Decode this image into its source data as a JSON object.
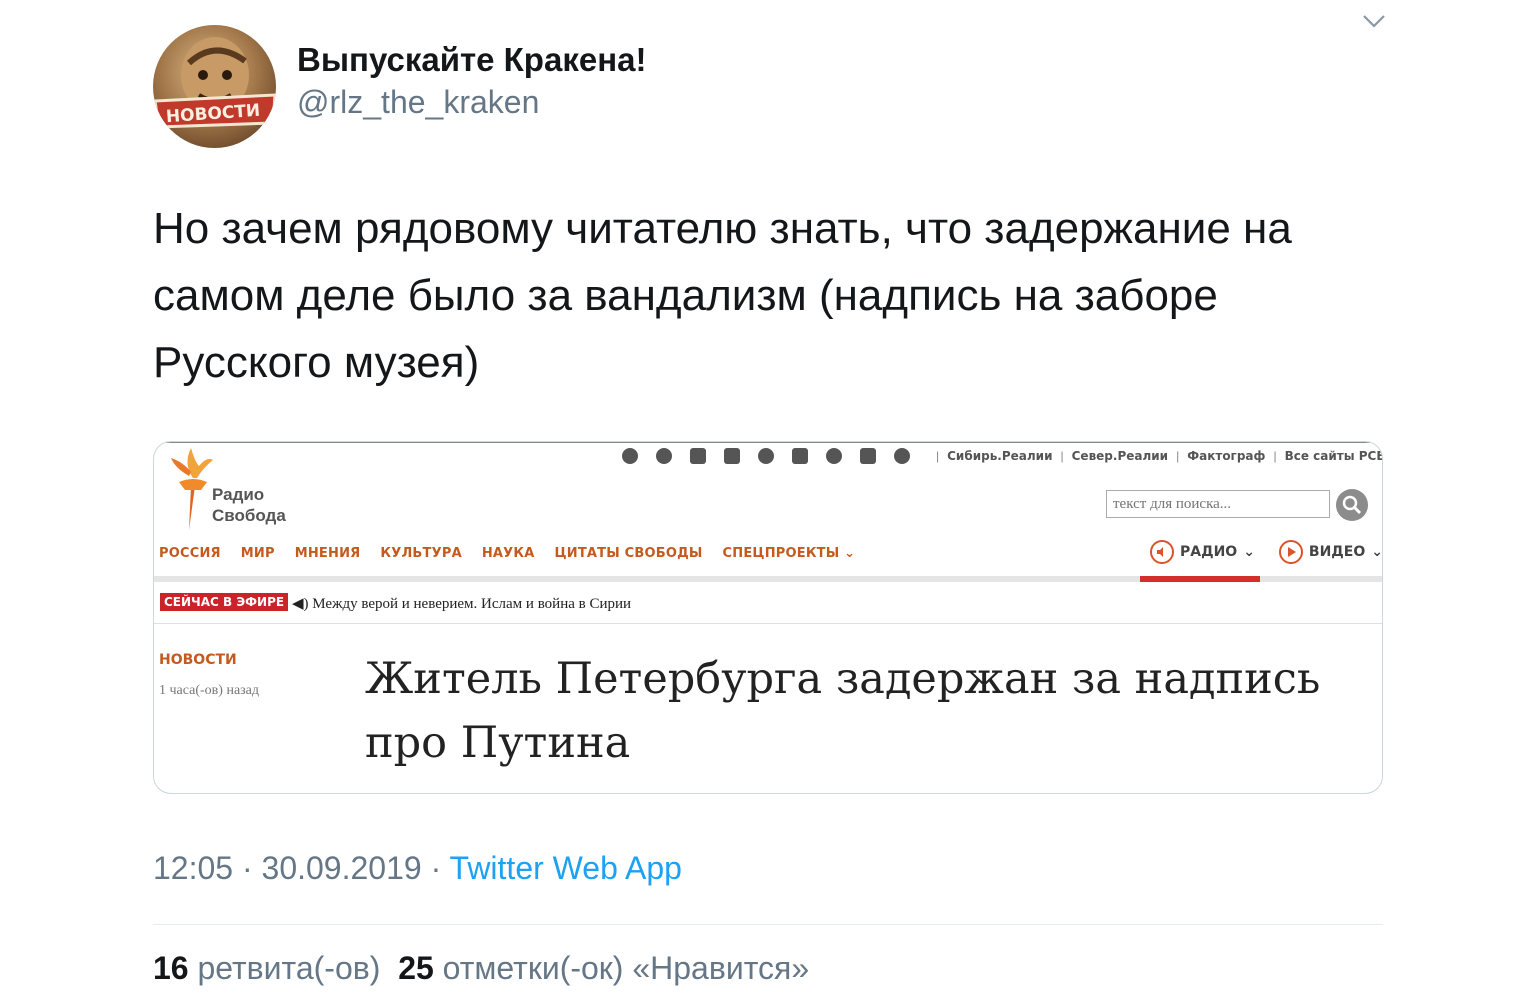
{
  "tweet": {
    "display_name": "Выпускайте Кракена!",
    "handle": "@rlz_the_kraken",
    "avatar_label": "НОВОСТИ",
    "text": "Но зачем рядовому читателю знать, что задержание на самом деле было за вандализм (надпись на заборе Русского музея)",
    "time": "12:05",
    "date": "30.09.2019",
    "source": "Twitter Web App",
    "retweets_count": "16",
    "retweets_label": "ретвита(-ов)",
    "likes_count": "25",
    "likes_label": "отметки(-ок) «Нравится»"
  },
  "card": {
    "top_links": [
      "Сибирь.Реалии",
      "Север.Реалии",
      "Фактограф",
      "Все сайты РСЕ/РС"
    ],
    "social_icons": [
      "facebook-icon",
      "twitter-icon",
      "youtube-icon",
      "vk-icon",
      "telegram-icon",
      "plus-icon",
      "soundcloud-icon",
      "instagram-icon",
      "odnoklassniki-icon"
    ],
    "logo_line1": "Радио",
    "logo_line2": "Свобода",
    "search_placeholder": "текст для поиска...",
    "nav": [
      "РОССИЯ",
      "МИР",
      "МНЕНИЯ",
      "КУЛЬТУРА",
      "НАУКА",
      "ЦИТАТЫ СВОБОДЫ",
      "СПЕЦПРОЕКТЫ"
    ],
    "radio_label": "РАДИО",
    "video_label": "ВИДЕО",
    "onair_badge": "СЕЙЧАС В ЭФИРЕ",
    "onair_text": "Между верой и неверием. Ислам и война в Сирии",
    "category": "НОВОСТИ",
    "time_ago": "1 часа(-ов) назад",
    "headline": "Житель Петербурга задержан за надпись про Путина"
  },
  "colors": {
    "link": "#1da1f2",
    "muted": "#657786",
    "accent_orange": "#c45a1e",
    "accent_red": "#cc2229"
  }
}
